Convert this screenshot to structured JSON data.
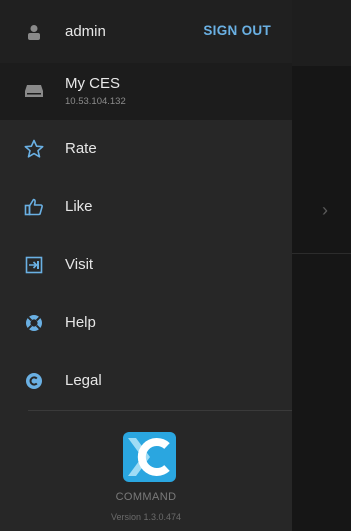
{
  "account": {
    "username": "admin",
    "sign_out": "SIGN OUT"
  },
  "server": {
    "name": "My CES",
    "ip": "10.53.104.132"
  },
  "menu": [
    {
      "label": "Rate",
      "icon": "star-outline-icon"
    },
    {
      "label": "Like",
      "icon": "thumbs-up-icon"
    },
    {
      "label": "Visit",
      "icon": "external-link-icon"
    },
    {
      "label": "Help",
      "icon": "lifebuoy-icon"
    },
    {
      "label": "Legal",
      "icon": "copyright-icon"
    }
  ],
  "footer": {
    "brand": "COMMAND",
    "version": "Version 1.3.0.474"
  },
  "colors": {
    "accent": "#6ab0e3",
    "logo": "#2aa6e0",
    "drawer": "#272727"
  }
}
